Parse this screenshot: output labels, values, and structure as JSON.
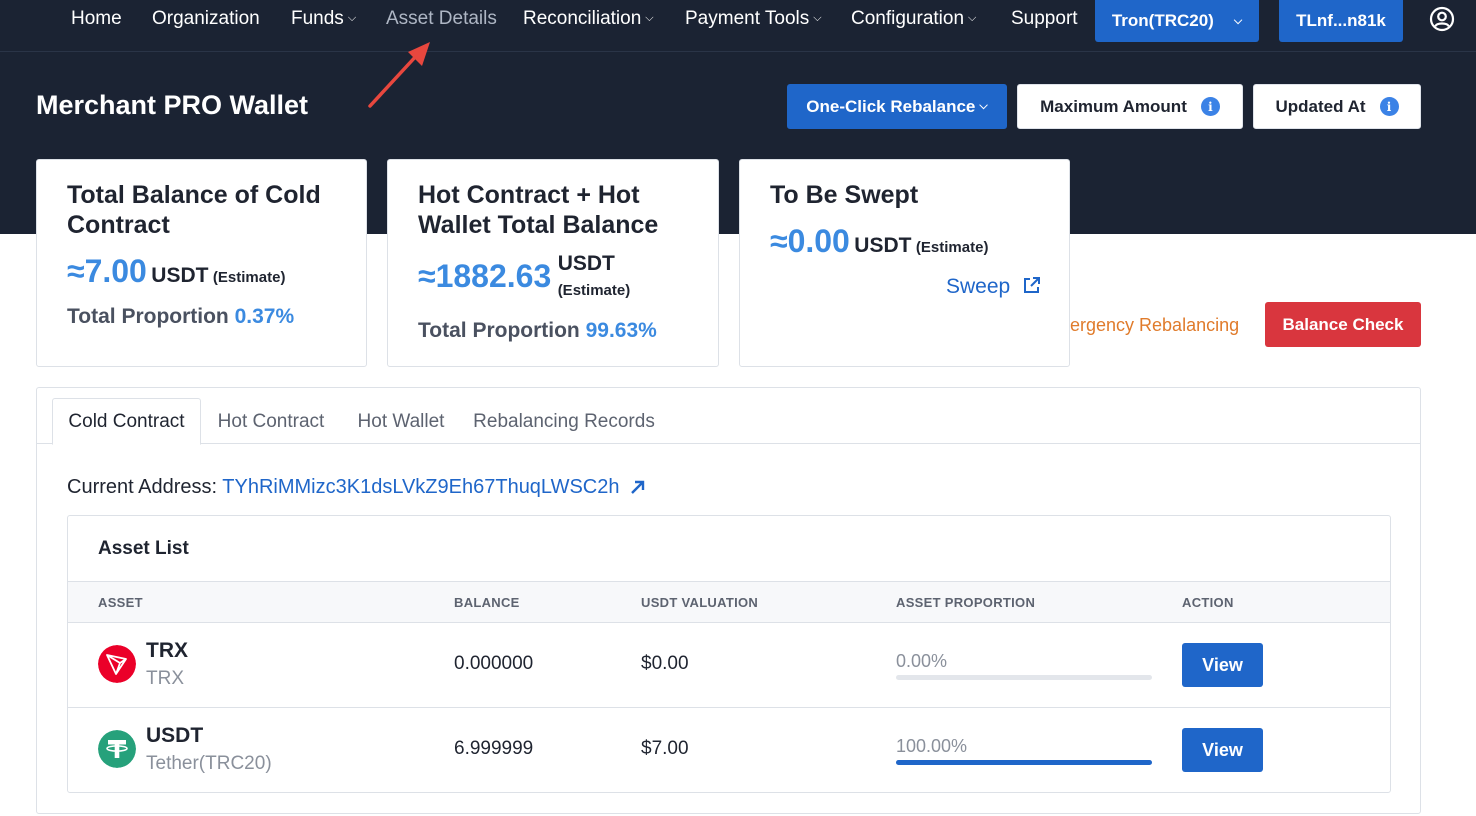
{
  "nav": {
    "items": [
      {
        "label": "Home",
        "dropdown": false
      },
      {
        "label": "Organization",
        "dropdown": false
      },
      {
        "label": "Funds",
        "dropdown": true
      },
      {
        "label": "Asset Details",
        "dropdown": false,
        "active": true
      },
      {
        "label": "Reconciliation",
        "dropdown": true
      },
      {
        "label": "Payment Tools",
        "dropdown": true
      },
      {
        "label": "Configuration",
        "dropdown": true
      },
      {
        "label": "Support",
        "dropdown": false
      }
    ],
    "network_label": "Tron(TRC20)",
    "account_label": "TLnf...n81k",
    "user_icon": "user-circle-icon"
  },
  "page": {
    "title": "Merchant PRO Wallet",
    "one_click_rebalance": "One-Click Rebalance",
    "maximum_amount": "Maximum Amount",
    "updated_at": "Updated At"
  },
  "cards": {
    "cold": {
      "title": "Total Balance of Cold Contract",
      "amount": "≈7.00",
      "unit": "USDT",
      "estimate": "(Estimate)",
      "proportion_label": "Total Proportion",
      "proportion_value": "0.37%"
    },
    "hot": {
      "title": "Hot Contract + Hot Wallet Total Balance",
      "amount": "≈1882.63",
      "unit": "USDT",
      "estimate": "(Estimate)",
      "proportion_label": "Total Proportion",
      "proportion_value": "99.63%"
    },
    "sweep": {
      "title": "To Be Swept",
      "amount": "≈0.00",
      "unit": "USDT",
      "estimate": "(Estimate)",
      "sweep_link": "Sweep"
    }
  },
  "actions": {
    "emergency_rebalancing": "ergency Rebalancing",
    "balance_check": "Balance Check"
  },
  "tabs": [
    "Cold Contract",
    "Hot Contract",
    "Hot Wallet",
    "Rebalancing Records"
  ],
  "address": {
    "label": "Current Address:",
    "value": "TYhRiMMizc3K1dsLVkZ9Eh67ThuqLWSC2h"
  },
  "asset_list": {
    "title": "Asset List",
    "columns": [
      "ASSET",
      "BALANCE",
      "USDT VALUATION",
      "ASSET PROPORTION",
      "ACTION"
    ],
    "rows": [
      {
        "symbol": "TRX",
        "name": "TRX",
        "balance": "0.000000",
        "valuation": "$0.00",
        "proportion": "0.00%",
        "proportion_fraction": 0.0,
        "action": "View",
        "icon": "trx-coin-icon",
        "color": "#eb0029"
      },
      {
        "symbol": "USDT",
        "name": "Tether(TRC20)",
        "balance": "6.999999",
        "valuation": "$7.00",
        "proportion": "100.00%",
        "proportion_fraction": 1.0,
        "action": "View",
        "icon": "usdt-coin-icon",
        "color": "#26a17b"
      }
    ]
  },
  "colors": {
    "header_bg": "#1b2333",
    "primary": "#1f66c9",
    "accent_blue": "#3b8ae0",
    "danger": "#d9363e",
    "warning_text": "#e07b2b",
    "annotation_arrow": "#e8473e"
  }
}
